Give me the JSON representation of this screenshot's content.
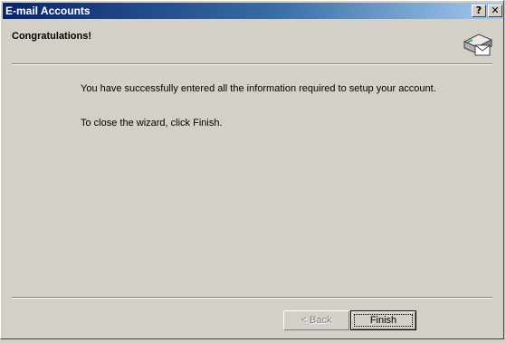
{
  "window": {
    "title": "E-mail Accounts",
    "help_button": "?",
    "close_button": "✕"
  },
  "header": {
    "title": "Congratulations!",
    "icon": "email-envelope-icon"
  },
  "body": {
    "line1": "You have successfully entered all the information required to setup your account.",
    "line2": "To close the wizard, click Finish."
  },
  "buttons": {
    "back_label": "< Back",
    "back_enabled": false,
    "finish_label": "Finish"
  },
  "colors": {
    "titlebar_start": "#0a246a",
    "titlebar_end": "#a6caf0",
    "face": "#d4d0c8"
  }
}
